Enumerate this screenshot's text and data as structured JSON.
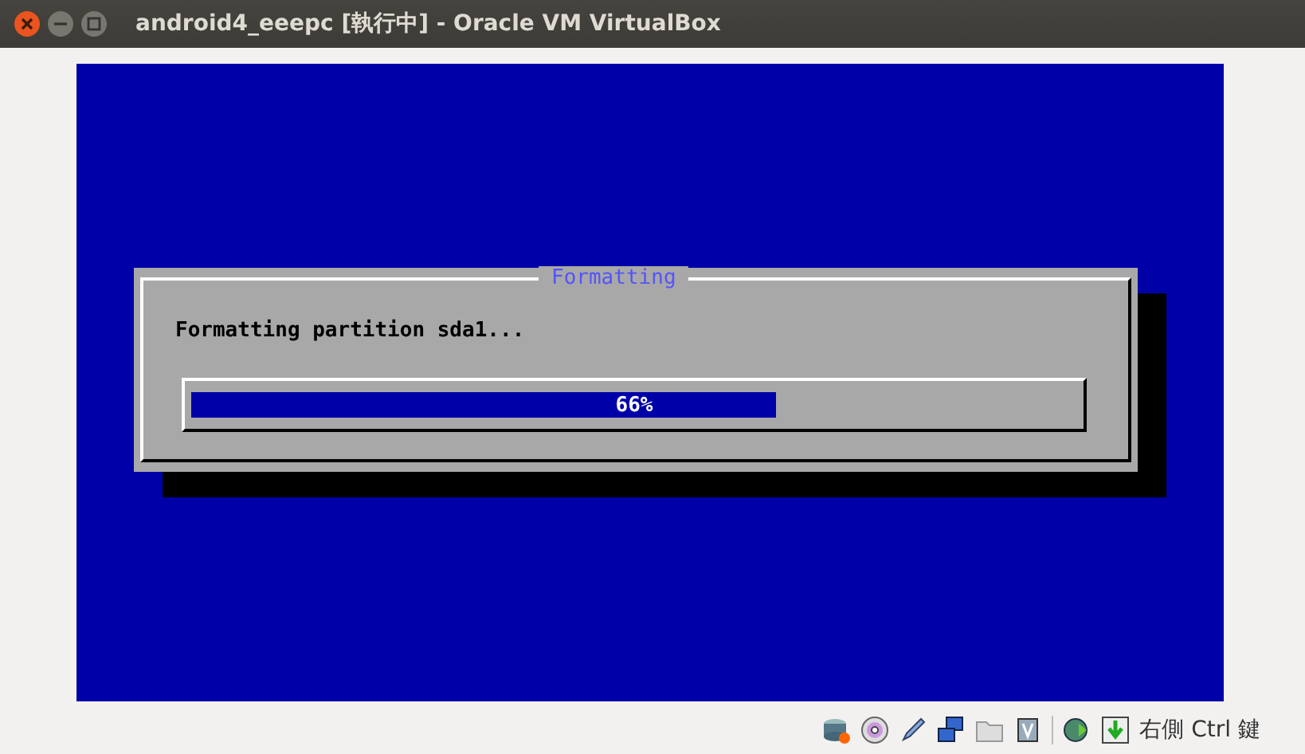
{
  "window": {
    "title": "android4_eeepc [執行中] - Oracle VM VirtualBox"
  },
  "dialog": {
    "title": "Formatting",
    "message": "Formatting partition sda1...",
    "progress": {
      "level": 0.66,
      "reading": "66%"
    }
  },
  "status_bar": {
    "host_key": "右側 Ctrl 鍵"
  }
}
